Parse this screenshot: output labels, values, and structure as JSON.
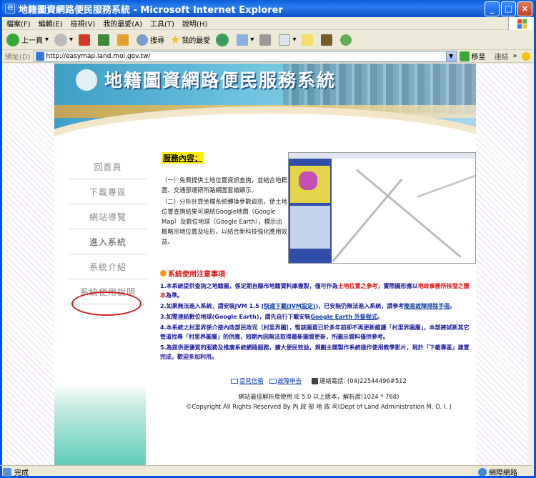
{
  "window": {
    "title": "地籍圖資網路便民服務系統 - Microsoft Internet Explorer"
  },
  "menu": [
    "檔案(F)",
    "編輯(E)",
    "檢視(V)",
    "我的最愛(A)",
    "工具(T)",
    "說明(H)"
  ],
  "toolbar": {
    "back": "上一頁",
    "search": "搜尋",
    "favorites": "我的最愛"
  },
  "address": {
    "label": "網址(D)",
    "url": "http://easymap.land.moi.gov.tw/",
    "go": "移至",
    "links": "連結"
  },
  "site": {
    "title": "地籍圖資網路便民服務系統"
  },
  "nav": [
    {
      "label": "回首頁"
    },
    {
      "label": "下載專區"
    },
    {
      "label": "網站導覽"
    },
    {
      "label": "進入系統"
    },
    {
      "label": "系統介紹"
    },
    {
      "label": "系統使用說明"
    }
  ],
  "service": {
    "title": "服務內容：",
    "p1": "（一）免費提供土地位置資訊查詢，並結合地籍圖、交通部運研所路網圖套繪顯示。",
    "p2": "（二）分析計算坐標系統轉換參數資訊，使土地位置查詢結果可連結Google地圖（Google Map）及數位地球（Google Earth），標示出概略宗地位置及坵形，以結合新科技強化應用效益。"
  },
  "notice": {
    "title": "系統使用注意事項",
    "i1a": "1.本系統提供查詢之地籍圖，係定期自縣市地籍資料庫複製，僅可作為",
    "i1b": "土地位置之參考",
    "i1c": "，實際圖形應以",
    "i1d": "地政事務所核發之謄本",
    "i1e": "為準。",
    "i2a": "2.如果無法進入系統，請安裝JVM 1.5 (",
    "i2b": "快速下載(JVM設定)",
    "i2c": ")，已安裝仍無法進入系統，請參考",
    "i2d": "簡易故障排除手冊",
    "i2e": "。",
    "i3a": "3.如需連結數位地球(Google Earth)，請先自行下載安裝",
    "i3b": "Google Earth 外掛程式",
    "i3c": "。",
    "i4": "4.本系統之村里界係介接內政部民政司〔村里界圖〕，惟該圖資已於多年前即不再更新維護「村里界圖層」，本部將試新其它管道找尋「村里界圖層」的供應，短期內因無法取得最新圖資更新，所圖示資料僅供參考。",
    "i5": "5.為提供更優質的服務及推廣系統網路服務，擴大便民效益，規劃主題製作系統操作使用教學影片，現於「下載專區」建置完成，歡迎多加利用。"
  },
  "contact": {
    "feedback": "意見信箱",
    "report": "故障申告",
    "phone": "連絡電話: (04)22544496#512"
  },
  "footer": {
    "resolution": "網站最佳解析度使用 IE 5.0 以上版本，解析度(1024 * 768)",
    "copyright": "©Copyright All Rights Reserved By 內 政 部 地 政 司(Dept of Land Administration M. O. I. )"
  },
  "status": {
    "left": "完成",
    "zone": "網際網路"
  },
  "colors": {
    "accent_red": "#d21a1a",
    "link_blue": "#0b3c9e",
    "notice_blue": "#1a1a9a",
    "highlight": "#ffef00"
  }
}
